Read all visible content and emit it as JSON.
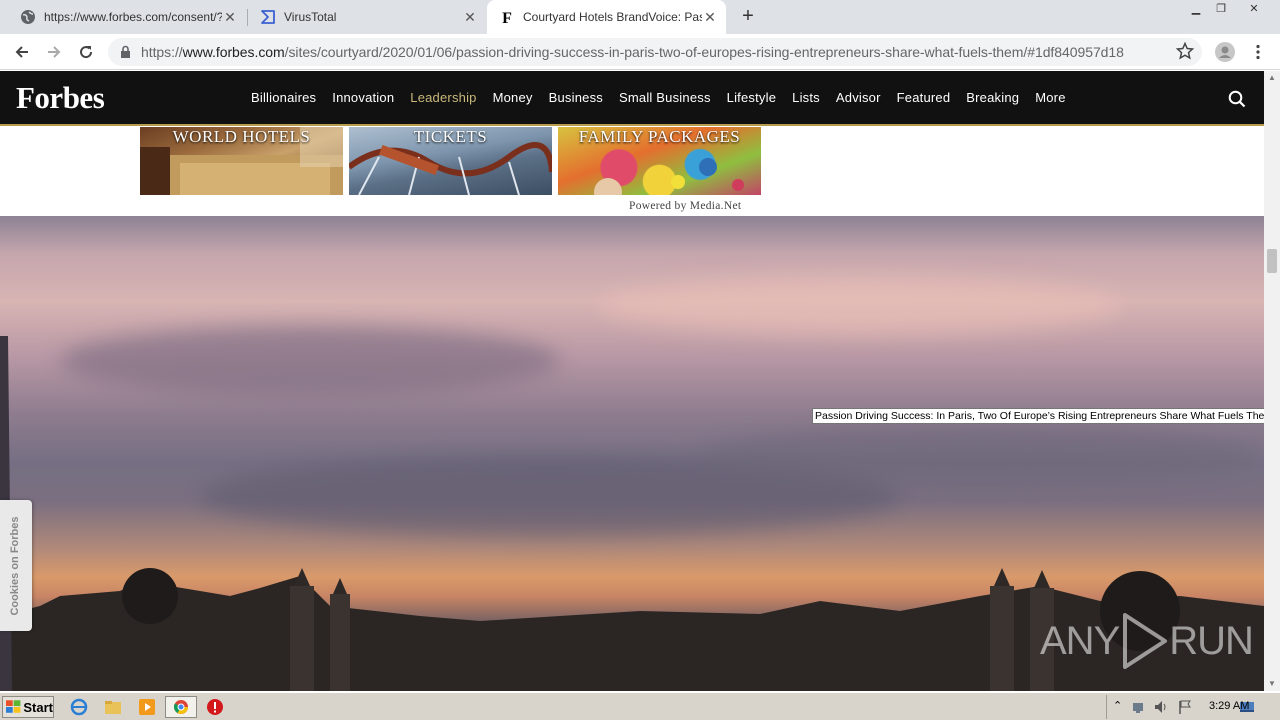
{
  "browser": {
    "tabs": [
      {
        "title": "https://www.forbes.com/consent/?t",
        "icon": "globe-icon"
      },
      {
        "title": "VirusTotal",
        "icon": "virustotal-icon"
      },
      {
        "title": "Courtyard Hotels BrandVoice: Passio",
        "icon": "forbes-f-icon",
        "active": true
      }
    ],
    "new_tab": "+",
    "address": {
      "scheme": "https://",
      "host": "www.forbes.com",
      "path": "/sites/courtyard/2020/01/06/passion-driving-success-in-paris-two-of-europes-rising-entrepreneurs-share-what-fuels-them/#1df840957d18"
    }
  },
  "forbes": {
    "logo": "Forbes",
    "menu": [
      {
        "label": "Billionaires"
      },
      {
        "label": "Innovation"
      },
      {
        "label": "Leadership",
        "active": true
      },
      {
        "label": "Money"
      },
      {
        "label": "Business"
      },
      {
        "label": "Small Business"
      },
      {
        "label": "Lifestyle"
      },
      {
        "label": "Lists"
      },
      {
        "label": "Advisor"
      },
      {
        "label": "Featured"
      },
      {
        "label": "Breaking"
      },
      {
        "label": "More"
      }
    ]
  },
  "ads": {
    "tiles": [
      {
        "caption": "WORLD HOTELS"
      },
      {
        "caption": "TICKETS"
      },
      {
        "caption": "FAMILY PACKAGES"
      }
    ],
    "powered_by": "Powered by Media.Net"
  },
  "hero": {
    "tooltip": "Passion Driving Success: In Paris, Two Of Europe’s Rising Entrepreneurs Share What Fuels Them",
    "cookies_tab": "Cookies on Forbes",
    "watermark_left": "ANY",
    "watermark_right": "RUN"
  },
  "taskbar": {
    "start": "Start",
    "clock": "3:29 AM"
  },
  "colors": {
    "forbes_nav_bg": "#111111",
    "forbes_accent": "#b89c4d",
    "active_menu": "#c9b97a"
  }
}
